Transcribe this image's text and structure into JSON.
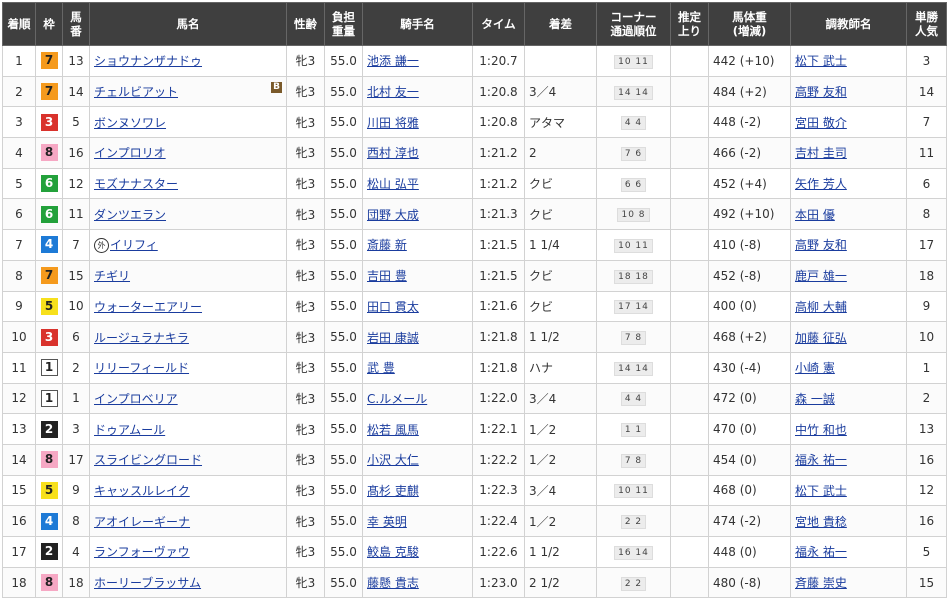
{
  "headers": {
    "rank": "着順",
    "waku": "枠",
    "umaban_1": "馬",
    "umaban_2": "番",
    "horse": "馬名",
    "sexage": "性齢",
    "weight_1": "負担",
    "weight_2": "重量",
    "jockey": "騎手名",
    "time": "タイム",
    "margin": "着差",
    "corner_1": "コーナー",
    "corner_2": "通過順位",
    "last_1": "推定",
    "last_2": "上り",
    "bodyweight_1": "馬体重",
    "bodyweight_2": "(増減)",
    "trainer": "調教師名",
    "pop_1": "単勝",
    "pop_2": "人気"
  },
  "colors": {
    "header_bg": "#3f3f3f",
    "link": "#1a3c9e",
    "waku_1": "#ffffff",
    "waku_2": "#222222",
    "waku_3": "#d9322c",
    "waku_4": "#1d7ad6",
    "waku_5": "#f7e01c",
    "waku_6": "#23a13b",
    "waku_7": "#f59a1d",
    "waku_8": "#f6a8c4"
  },
  "rows": [
    {
      "rank": "1",
      "waku": "7",
      "umaban": "13",
      "horse": "ショウナンザナドゥ",
      "blinker": "",
      "foreign": "",
      "sexage": "牝3",
      "weight": "55.0",
      "jockey": "池添 謙一",
      "time": "1:20.7",
      "margin": "",
      "corner": "10 11",
      "last": "",
      "bodyweight": "442 (+10)",
      "trainer": "松下 武士",
      "pop": "3"
    },
    {
      "rank": "2",
      "waku": "7",
      "umaban": "14",
      "horse": "チェルビアット",
      "blinker": "B",
      "foreign": "",
      "sexage": "牝3",
      "weight": "55.0",
      "jockey": "北村 友一",
      "time": "1:20.8",
      "margin": "3／4",
      "corner": "14 14",
      "last": "",
      "bodyweight": "484 (+2)",
      "trainer": "高野 友和",
      "pop": "14"
    },
    {
      "rank": "3",
      "waku": "3",
      "umaban": "5",
      "horse": "ボンヌソワレ",
      "blinker": "",
      "foreign": "",
      "sexage": "牝3",
      "weight": "55.0",
      "jockey": "川田 将雅",
      "time": "1:20.8",
      "margin": "アタマ",
      "corner": "4 4",
      "last": "",
      "bodyweight": "448 (-2)",
      "trainer": "宮田 敬介",
      "pop": "7"
    },
    {
      "rank": "4",
      "waku": "8",
      "umaban": "16",
      "horse": "インプロリオ",
      "blinker": "",
      "foreign": "",
      "sexage": "牝3",
      "weight": "55.0",
      "jockey": "西村 淳也",
      "time": "1:21.2",
      "margin": "2",
      "corner": "7 6",
      "last": "",
      "bodyweight": "466 (-2)",
      "trainer": "吉村 圭司",
      "pop": "11"
    },
    {
      "rank": "5",
      "waku": "6",
      "umaban": "12",
      "horse": "モズナナスター",
      "blinker": "",
      "foreign": "",
      "sexage": "牝3",
      "weight": "55.0",
      "jockey": "松山 弘平",
      "time": "1:21.2",
      "margin": "クビ",
      "corner": "6 6",
      "last": "",
      "bodyweight": "452 (+4)",
      "trainer": "矢作 芳人",
      "pop": "6"
    },
    {
      "rank": "6",
      "waku": "6",
      "umaban": "11",
      "horse": "ダンツエラン",
      "blinker": "",
      "foreign": "",
      "sexage": "牝3",
      "weight": "55.0",
      "jockey": "団野 大成",
      "time": "1:21.3",
      "margin": "クビ",
      "corner": "10 8",
      "last": "",
      "bodyweight": "492 (+10)",
      "trainer": "本田 優",
      "pop": "8"
    },
    {
      "rank": "7",
      "waku": "4",
      "umaban": "7",
      "horse": "イリフィ",
      "blinker": "",
      "foreign": "外",
      "sexage": "牝3",
      "weight": "55.0",
      "jockey": "斎藤 新",
      "time": "1:21.5",
      "margin": "1 1/4",
      "corner": "10 11",
      "last": "",
      "bodyweight": "410 (-8)",
      "trainer": "高野 友和",
      "pop": "17"
    },
    {
      "rank": "8",
      "waku": "7",
      "umaban": "15",
      "horse": "チギリ",
      "blinker": "",
      "foreign": "",
      "sexage": "牝3",
      "weight": "55.0",
      "jockey": "吉田 豊",
      "time": "1:21.5",
      "margin": "クビ",
      "corner": "18 18",
      "last": "",
      "bodyweight": "452 (-8)",
      "trainer": "鹿戸 雄一",
      "pop": "18"
    },
    {
      "rank": "9",
      "waku": "5",
      "umaban": "10",
      "horse": "ウォーターエアリー",
      "blinker": "",
      "foreign": "",
      "sexage": "牝3",
      "weight": "55.0",
      "jockey": "田口 貫太",
      "time": "1:21.6",
      "margin": "クビ",
      "corner": "17 14",
      "last": "",
      "bodyweight": "400 (0)",
      "trainer": "高柳 大輔",
      "pop": "9"
    },
    {
      "rank": "10",
      "waku": "3",
      "umaban": "6",
      "horse": "ルージュラナキラ",
      "blinker": "",
      "foreign": "",
      "sexage": "牝3",
      "weight": "55.0",
      "jockey": "岩田 康誠",
      "time": "1:21.8",
      "margin": "1 1/2",
      "corner": "7 8",
      "last": "",
      "bodyweight": "468 (+2)",
      "trainer": "加藤 征弘",
      "pop": "10"
    },
    {
      "rank": "11",
      "waku": "1",
      "umaban": "2",
      "horse": "リリーフィールド",
      "blinker": "",
      "foreign": "",
      "sexage": "牝3",
      "weight": "55.0",
      "jockey": "武 豊",
      "time": "1:21.8",
      "margin": "ハナ",
      "corner": "14 14",
      "last": "",
      "bodyweight": "430 (-4)",
      "trainer": "小崎 憲",
      "pop": "1"
    },
    {
      "rank": "12",
      "waku": "1",
      "umaban": "1",
      "horse": "インプロベリア",
      "blinker": "",
      "foreign": "",
      "sexage": "牝3",
      "weight": "55.0",
      "jockey": "C.ルメール",
      "time": "1:22.0",
      "margin": "3／4",
      "corner": "4 4",
      "last": "",
      "bodyweight": "472 (0)",
      "trainer": "森 一誠",
      "pop": "2"
    },
    {
      "rank": "13",
      "waku": "2",
      "umaban": "3",
      "horse": "ドゥアムール",
      "blinker": "",
      "foreign": "",
      "sexage": "牝3",
      "weight": "55.0",
      "jockey": "松若 風馬",
      "time": "1:22.1",
      "margin": "1／2",
      "corner": "1 1",
      "last": "",
      "bodyweight": "470 (0)",
      "trainer": "中竹 和也",
      "pop": "13"
    },
    {
      "rank": "14",
      "waku": "8",
      "umaban": "17",
      "horse": "スライビングロード",
      "blinker": "",
      "foreign": "",
      "sexage": "牝3",
      "weight": "55.0",
      "jockey": "小沢 大仁",
      "time": "1:22.2",
      "margin": "1／2",
      "corner": "7 8",
      "last": "",
      "bodyweight": "454 (0)",
      "trainer": "福永 祐一",
      "pop": "16"
    },
    {
      "rank": "15",
      "waku": "5",
      "umaban": "9",
      "horse": "キャッスルレイク",
      "blinker": "",
      "foreign": "",
      "sexage": "牝3",
      "weight": "55.0",
      "jockey": "髙杉 吏麒",
      "time": "1:22.3",
      "margin": "3／4",
      "corner": "10 11",
      "last": "",
      "bodyweight": "468 (0)",
      "trainer": "松下 武士",
      "pop": "12"
    },
    {
      "rank": "16",
      "waku": "4",
      "umaban": "8",
      "horse": "アオイレーギーナ",
      "blinker": "",
      "foreign": "",
      "sexage": "牝3",
      "weight": "55.0",
      "jockey": "幸 英明",
      "time": "1:22.4",
      "margin": "1／2",
      "corner": "2 2",
      "last": "",
      "bodyweight": "474 (-2)",
      "trainer": "宮地 貴稔",
      "pop": "16"
    },
    {
      "rank": "17",
      "waku": "2",
      "umaban": "4",
      "horse": "ランフォーヴァウ",
      "blinker": "",
      "foreign": "",
      "sexage": "牝3",
      "weight": "55.0",
      "jockey": "鮫島 克駿",
      "time": "1:22.6",
      "margin": "1 1/2",
      "corner": "16 14",
      "last": "",
      "bodyweight": "448 (0)",
      "trainer": "福永 祐一",
      "pop": "5"
    },
    {
      "rank": "18",
      "waku": "8",
      "umaban": "18",
      "horse": "ホーリーブラッサム",
      "blinker": "",
      "foreign": "",
      "sexage": "牝3",
      "weight": "55.0",
      "jockey": "藤懸 貴志",
      "time": "1:23.0",
      "margin": "2 1/2",
      "corner": "2 2",
      "last": "",
      "bodyweight": "480 (-8)",
      "trainer": "斉藤 崇史",
      "pop": "15"
    }
  ]
}
